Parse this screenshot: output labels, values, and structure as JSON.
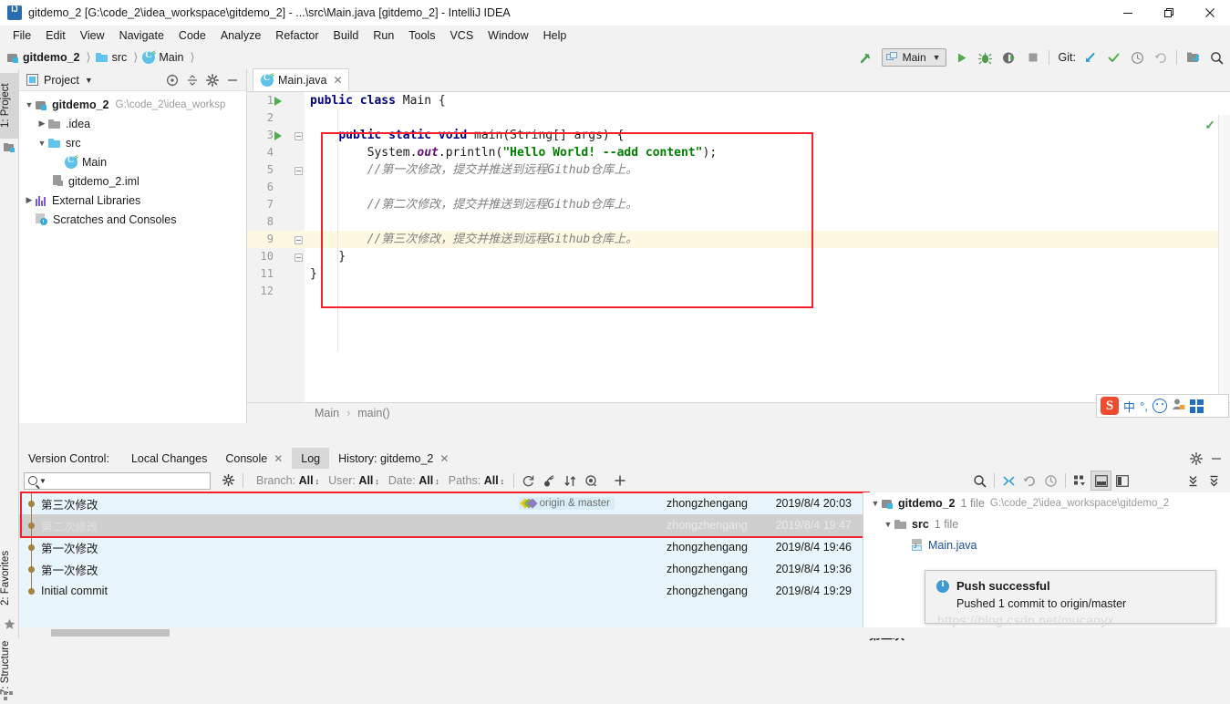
{
  "window": {
    "title": "gitdemo_2 [G:\\code_2\\idea_workspace\\gitdemo_2] - ...\\src\\Main.java [gitdemo_2] - IntelliJ IDEA",
    "app_icon": "intellij-idea-icon",
    "minimize": "minimize-icon",
    "maximize": "restore-icon",
    "close": "close-icon"
  },
  "menubar": {
    "items": [
      {
        "label": "File"
      },
      {
        "label": "Edit"
      },
      {
        "label": "View"
      },
      {
        "label": "Navigate"
      },
      {
        "label": "Code"
      },
      {
        "label": "Analyze"
      },
      {
        "label": "Refactor"
      },
      {
        "label": "Build"
      },
      {
        "label": "Run"
      },
      {
        "label": "Tools"
      },
      {
        "label": "VCS"
      },
      {
        "label": "Window"
      },
      {
        "label": "Help"
      }
    ]
  },
  "navbar": {
    "breadcrumbs": [
      {
        "label": "gitdemo_2",
        "icon": "project-module-icon"
      },
      {
        "label": "src",
        "icon": "folder-icon"
      },
      {
        "label": "Main",
        "icon": "java-class-icon"
      }
    ],
    "build_icon": "hammer-icon",
    "run_config": {
      "label": "Main",
      "chevron": "chevron-down-icon",
      "icon": "run-configuration-icon"
    },
    "run_icon": "run-icon",
    "debug_icon": "debug-icon",
    "run_coverage_icon": "run-with-coverage-icon",
    "stop_icon": "stop-icon",
    "git_label": "Git:",
    "update_project_icon": "update-project-icon",
    "commit_icon": "commit-checkmark-icon",
    "history_icon": "history-clock-icon",
    "rollback_icon": "rollback-icon",
    "project_structure_icon": "project-structure-icon",
    "search_icon": "search-everywhere-icon"
  },
  "left_rail": {
    "tabs": [
      {
        "label": "1: Project",
        "selected": true,
        "icon": "project-tool-icon"
      },
      {
        "label": "2: Favorites",
        "selected": false,
        "icon": "star-icon"
      },
      {
        "label": "7: Structure",
        "selected": false,
        "icon": "structure-icon"
      }
    ]
  },
  "project_panel": {
    "title": "Project",
    "chevron": "chevron-down-icon",
    "buttons": [
      {
        "name": "scroll-from-source-icon"
      },
      {
        "name": "collapse-all-icon"
      },
      {
        "name": "settings-gear-icon"
      },
      {
        "name": "hide-icon"
      }
    ],
    "tree": [
      {
        "indent": 0,
        "arrow": "expanded",
        "icon": "project-module-icon",
        "label": "gitdemo_2",
        "bold": true,
        "path": "G:\\code_2\\idea_worksp"
      },
      {
        "indent": 1,
        "arrow": "collapsed",
        "icon": "folder-grey-icon",
        "label": ".idea",
        "bold": false,
        "path": ""
      },
      {
        "indent": 1,
        "arrow": "expanded",
        "icon": "folder-icon",
        "label": "src",
        "bold": false,
        "path": ""
      },
      {
        "indent": 2,
        "arrow": "none",
        "icon": "java-class-icon",
        "label": "Main",
        "bold": false,
        "path": ""
      },
      {
        "indent": 1,
        "arrow": "none",
        "icon": "iml-file-icon",
        "label": "gitdemo_2.iml",
        "bold": false,
        "path": ""
      },
      {
        "indent": 0,
        "arrow": "collapsed",
        "icon": "external-libraries-icon",
        "label": "External Libraries",
        "bold": false,
        "path": ""
      },
      {
        "indent": 0,
        "arrow": "none",
        "icon": "scratches-icon",
        "label": "Scratches and Consoles",
        "bold": false,
        "path": ""
      }
    ]
  },
  "editor": {
    "tab": {
      "label": "Main.java",
      "icon": "java-class-icon",
      "close": "close-icon"
    },
    "status_check_icon": "inspection-ok-icon",
    "breadcrumbs": [
      {
        "label": "Main"
      },
      {
        "label": "main()"
      }
    ],
    "breadcrumb_separator": "›",
    "lines": [
      {
        "num": "1",
        "run": true,
        "fold": "none",
        "highlight": false,
        "tokens": [
          {
            "t": "kw",
            "v": "public class "
          },
          {
            "t": "n",
            "v": "Main {"
          }
        ]
      },
      {
        "num": "2",
        "run": false,
        "fold": "none",
        "highlight": false,
        "tokens": []
      },
      {
        "num": "3",
        "run": true,
        "fold": "open",
        "highlight": false,
        "tokens": [
          {
            "t": "n",
            "v": "    "
          },
          {
            "t": "kw",
            "v": "public static void "
          },
          {
            "t": "n",
            "v": "main(String[] args) {"
          }
        ]
      },
      {
        "num": "4",
        "run": false,
        "fold": "none",
        "highlight": false,
        "tokens": [
          {
            "t": "n",
            "v": "        System."
          },
          {
            "t": "fld",
            "v": "out"
          },
          {
            "t": "n",
            "v": ".println("
          },
          {
            "t": "str",
            "v": "\"Hello World! --add content\""
          },
          {
            "t": "n",
            "v": ");"
          }
        ]
      },
      {
        "num": "5",
        "run": false,
        "fold": "open",
        "highlight": false,
        "tokens": [
          {
            "t": "cmt",
            "v": "        //第一次修改，提交并推送到远程Github仓库上。"
          }
        ]
      },
      {
        "num": "6",
        "run": false,
        "fold": "none",
        "highlight": false,
        "tokens": []
      },
      {
        "num": "7",
        "run": false,
        "fold": "none",
        "highlight": false,
        "tokens": [
          {
            "t": "cmt",
            "v": "        //第二次修改，提交并推送到远程Github仓库上。"
          }
        ]
      },
      {
        "num": "8",
        "run": false,
        "fold": "none",
        "highlight": false,
        "tokens": []
      },
      {
        "num": "9",
        "run": false,
        "fold": "open",
        "highlight": true,
        "tokens": [
          {
            "t": "cmt",
            "v": "        //第三次修改，提交并推送到远程Github仓库上。"
          }
        ]
      },
      {
        "num": "10",
        "run": false,
        "fold": "open",
        "highlight": false,
        "tokens": [
          {
            "t": "n",
            "v": "    }"
          }
        ]
      },
      {
        "num": "11",
        "run": false,
        "fold": "none",
        "highlight": false,
        "tokens": [
          {
            "t": "n",
            "v": "}"
          }
        ]
      },
      {
        "num": "12",
        "run": false,
        "fold": "none",
        "highlight": false,
        "tokens": []
      }
    ]
  },
  "ime": {
    "logo": "sogou-logo-icon",
    "mode": "中",
    "punct": "°,",
    "emoji": "smiley-icon",
    "user": "user-icon",
    "panel": "toolbox-icon"
  },
  "vcs": {
    "panel_label": "Version Control:",
    "tabs": [
      {
        "label": "Local Changes",
        "selected": false,
        "closable": false
      },
      {
        "label": "Console",
        "selected": false,
        "closable": true
      },
      {
        "label": "Log",
        "selected": true,
        "closable": false
      },
      {
        "label": "History: gitdemo_2",
        "selected": false,
        "closable": true
      }
    ],
    "panel_buttons": [
      {
        "name": "settings-gear-icon"
      },
      {
        "name": "hide-icon"
      }
    ],
    "toolbar": {
      "search_placeholder": "",
      "search_icon": "search-icon",
      "search_chevron": "chevron-down-icon",
      "gear_icon": "settings-gear-icon",
      "filters": [
        {
          "label": "Branch:",
          "value": "All"
        },
        {
          "label": "User:",
          "value": "All"
        },
        {
          "label": "Date:",
          "value": "All"
        },
        {
          "label": "Paths:",
          "value": "All"
        }
      ],
      "icons": [
        {
          "name": "refresh-icon"
        },
        {
          "name": "cherry-pick-icon"
        },
        {
          "name": "intellisort-icon"
        },
        {
          "name": "show-details-eye-icon"
        },
        {
          "name": "add-icon"
        }
      ],
      "right_icons": [
        {
          "name": "find-icon"
        },
        {
          "name": "collapse-arrows-icon"
        },
        {
          "name": "revert-icon"
        },
        {
          "name": "history-clock-icon"
        },
        {
          "name": "group-by-icon"
        },
        {
          "name": "preview-bottom-icon"
        },
        {
          "name": "preview-right-icon"
        },
        {
          "name": "expand-all-icon"
        },
        {
          "name": "collapse-all-icon"
        }
      ]
    },
    "commits": [
      {
        "subject": "第三次修改",
        "tag": "origin & master",
        "author": "zhongzhengang",
        "date": "2019/8/4 20:03",
        "selected": false
      },
      {
        "subject": "第二次修改",
        "tag": "",
        "author": "zhongzhengang",
        "date": "2019/8/4 19:47",
        "selected": true
      },
      {
        "subject": "第一次修改",
        "tag": "",
        "author": "zhongzhengang",
        "date": "2019/8/4 19:46",
        "selected": false
      },
      {
        "subject": "第一次修改",
        "tag": "",
        "author": "zhongzhengang",
        "date": "2019/8/4 19:36",
        "selected": false
      },
      {
        "subject": "Initial commit",
        "tag": "",
        "author": "zhongzhengang",
        "date": "2019/8/4 19:29",
        "selected": false
      }
    ],
    "changed_files": [
      {
        "indent": 0,
        "arrow": "expanded",
        "icon": "project-module-icon",
        "label": "gitdemo_2",
        "bold": true,
        "count": "1 file",
        "path": "G:\\code_2\\idea_workspace\\gitdemo_2"
      },
      {
        "indent": 1,
        "arrow": "expanded",
        "icon": "folder-grey-icon",
        "label": "src",
        "bold": true,
        "count": "1 file",
        "path": ""
      },
      {
        "indent": 2,
        "arrow": "none",
        "icon": "java-file-icon",
        "label": "Main.java",
        "bold": false,
        "count": "",
        "path": ""
      }
    ],
    "detail_text": "第二次"
  },
  "notification": {
    "icon": "info-icon",
    "title": "Push successful",
    "message": "Pushed 1 commit to origin/master"
  },
  "watermark": "https://blog.csdn.net/mucaoyx",
  "colors": {
    "accent_red": "#f5222d",
    "selection_blue": "#e8f5fc",
    "selected_row": "#cfcfcf",
    "keyword": "#000080",
    "string": "#008000",
    "comment": "#808080",
    "field": "#660e7a",
    "green": "#4eae4e",
    "link_blue": "#1f6fc4"
  }
}
